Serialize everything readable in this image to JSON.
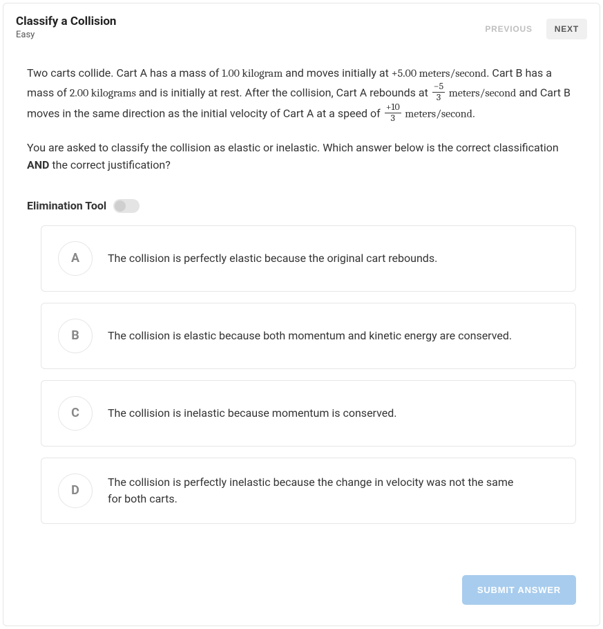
{
  "header": {
    "title": "Classify a Collision",
    "difficulty": "Easy",
    "prev_label": "PREVIOUS",
    "next_label": "NEXT"
  },
  "problem": {
    "p1_a": "Two carts collide. Cart A has a mass of ",
    "massA": "1.00 kilogram",
    "p1_b": " and moves initially at ",
    "velA_i": "+5.00 meters/second",
    "p1_c": ". Cart B has a mass of ",
    "massB": "2.00 kilograms",
    "p1_d": " and is initially at rest. After the collision, Cart A rebounds at ",
    "fracA_num": "−5",
    "fracA_den": "3",
    "unit1": " meters/second",
    "p1_e": " and Cart B moves in the same direction as the initial velocity of Cart A at a speed of ",
    "fracB_num": "+10",
    "fracB_den": "3",
    "unit2": " meters/second",
    "p1_f": "."
  },
  "question": {
    "q_a": "You are asked to classify the collision as elastic or inelastic. Which answer below is the correct classification ",
    "q_bold": "AND",
    "q_b": " the correct justification?"
  },
  "elimination": {
    "label": "Elimination Tool",
    "on": false
  },
  "options": [
    {
      "letter": "A",
      "text": "The collision is perfectly elastic because the original cart rebounds."
    },
    {
      "letter": "B",
      "text": "The collision is elastic because both momentum and kinetic energy are conserved."
    },
    {
      "letter": "C",
      "text": "The collision is inelastic because momentum is conserved."
    },
    {
      "letter": "D",
      "text": "The collision is perfectly inelastic because the change in velocity was not the same for both carts."
    }
  ],
  "footer": {
    "submit_label": "SUBMIT ANSWER"
  }
}
